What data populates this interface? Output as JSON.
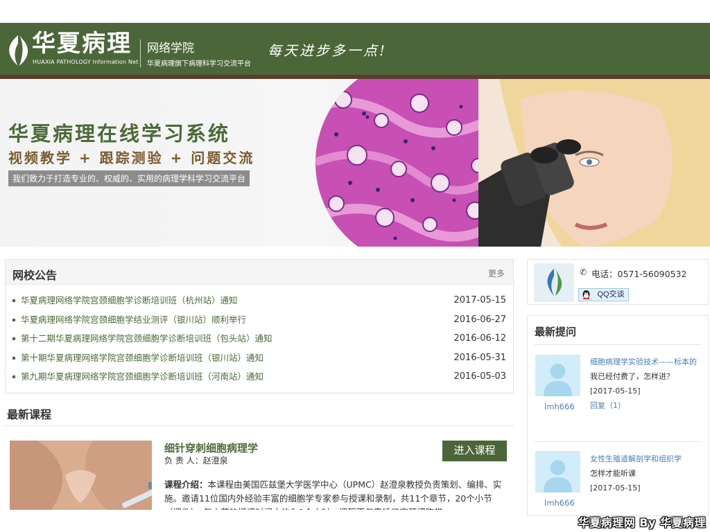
{
  "header": {
    "logo_text": "华夏病理",
    "logo_sub": "HUAXIA PATHOLOGY Information Net",
    "college": "网络学院",
    "college_sub": "华夏病理旗下病理科学习交流平台",
    "slogan": "每天进步多一点!"
  },
  "banner": {
    "title": "华夏病理在线学习系统",
    "features": "视频教学 + 跟踪测验 + 问题交流",
    "tagline": "我们致力于打造专业的、权威的、实用的病理学科学习交流平台"
  },
  "notice": {
    "title": "网校公告",
    "more": "更多",
    "items": [
      {
        "text": "华夏病理网络学院宫颈细胞学诊断培训班（杭州站）通知",
        "date": "2017-05-15"
      },
      {
        "text": "华夏病理网络学院宫颈细胞学结业测评（银川站）顺利举行",
        "date": "2016-06-27"
      },
      {
        "text": "第十二期华夏病理网络学院宫颈细胞学诊断培训班（包头站）通知",
        "date": "2016-06-12"
      },
      {
        "text": "第十期华夏病理网络学院宫颈细胞学诊断培训班（银川站）通知",
        "date": "2016-05-31"
      },
      {
        "text": "第九期华夏病理网络学院宫颈细胞学诊断培训班（河南站）通知",
        "date": "2016-05-03"
      }
    ]
  },
  "courses": {
    "title": "最新课程",
    "items": [
      {
        "name": "细针穿刺细胞病理学",
        "teacher": "负 责 人：赵澄泉",
        "enter_label": "进入课程",
        "intro_label": "课程介绍：",
        "intro": "本课程由美国匹兹堡大学医学中心（UPMC）赵澄泉教授负责策划、编排、实施。邀请11位国内外经验丰富的细胞学专家参与授课和录制，共11个章节，20个小节（课件），每小节的授课时间大约为1个小时，课程不仅囊括了宫颈细胞学"
      }
    ]
  },
  "contact": {
    "phone": "电话：0571-56090532",
    "qq_label": "QQ交谈"
  },
  "questions": {
    "title": "最新提问",
    "items": [
      {
        "user": "lmh666",
        "title": "细胞病理学实验技术——标本的",
        "body": "我已经付费了，怎样进？",
        "date": "[2017-05-15]",
        "reply": "回复（1）"
      },
      {
        "user": "lmh666",
        "title": "女性生殖道解剖学和组织学",
        "body": "怎样才能听课",
        "date": "[2017-05-15]",
        "reply": ""
      }
    ]
  },
  "watermark": "华夏病理网 By 华夏病理",
  "colors": {
    "brand_green": "#4b6638",
    "accent_brown": "#5a3d2b",
    "link_blue": "#4a7fb5"
  }
}
